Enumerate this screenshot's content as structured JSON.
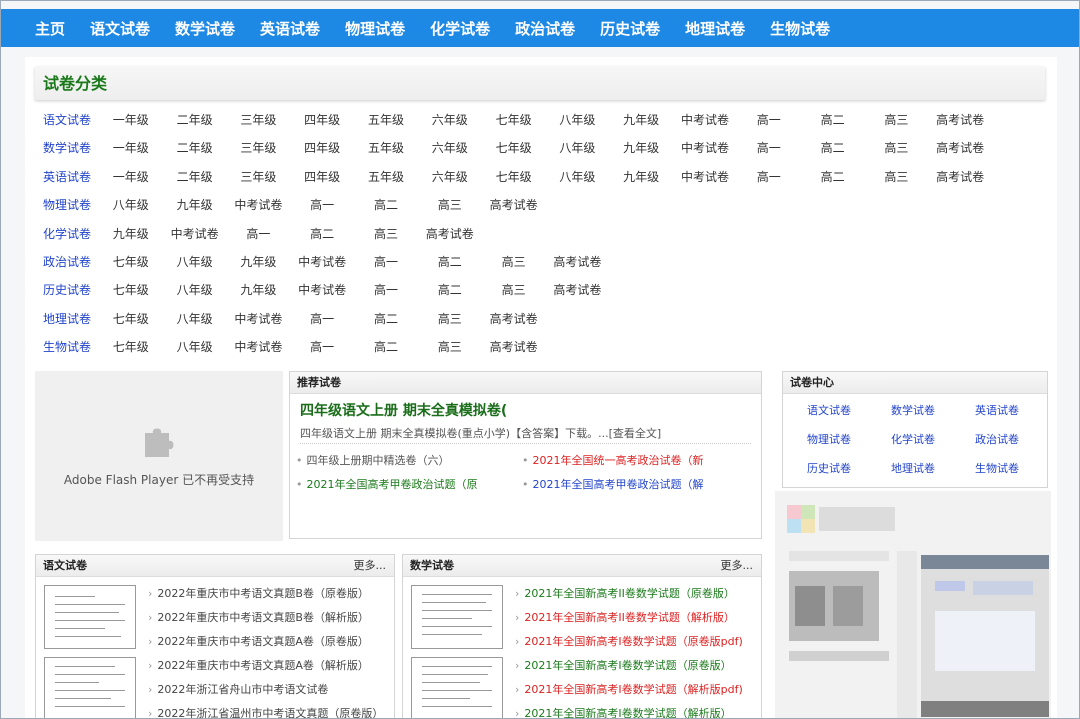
{
  "nav": [
    "主页",
    "语文试卷",
    "数学试卷",
    "英语试卷",
    "物理试卷",
    "化学试卷",
    "政治试卷",
    "历史试卷",
    "地理试卷",
    "生物试卷"
  ],
  "category": {
    "title": "试卷分类",
    "rows": [
      [
        "语文试卷",
        "一年级",
        "二年级",
        "三年级",
        "四年级",
        "五年级",
        "六年级",
        "七年级",
        "八年级",
        "九年级",
        "中考试卷",
        "高一",
        "高二",
        "高三",
        "高考试卷"
      ],
      [
        "数学试卷",
        "一年级",
        "二年级",
        "三年级",
        "四年级",
        "五年级",
        "六年级",
        "七年级",
        "八年级",
        "九年级",
        "中考试卷",
        "高一",
        "高二",
        "高三",
        "高考试卷"
      ],
      [
        "英语试卷",
        "一年级",
        "二年级",
        "三年级",
        "四年级",
        "五年级",
        "六年级",
        "七年级",
        "八年级",
        "九年级",
        "中考试卷",
        "高一",
        "高二",
        "高三",
        "高考试卷"
      ],
      [
        "物理试卷",
        "八年级",
        "九年级",
        "中考试卷",
        "高一",
        "高二",
        "高三",
        "高考试卷"
      ],
      [
        "化学试卷",
        "九年级",
        "中考试卷",
        "高一",
        "高二",
        "高三",
        "高考试卷"
      ],
      [
        "政治试卷",
        "七年级",
        "八年级",
        "九年级",
        "中考试卷",
        "高一",
        "高二",
        "高三",
        "高考试卷"
      ],
      [
        "历史试卷",
        "七年级",
        "八年级",
        "九年级",
        "中考试卷",
        "高一",
        "高二",
        "高三",
        "高考试卷"
      ],
      [
        "地理试卷",
        "七年级",
        "八年级",
        "中考试卷",
        "高一",
        "高二",
        "高三",
        "高考试卷"
      ],
      [
        "生物试卷",
        "七年级",
        "八年级",
        "中考试卷",
        "高一",
        "高二",
        "高三",
        "高考试卷"
      ]
    ]
  },
  "flash": {
    "text": "Adobe Flash Player 已不再受支持",
    "icon": "puzzle-icon"
  },
  "recommend": {
    "header": "推荐试卷",
    "headline": "四年级语文上册 期末全真模拟卷(",
    "desc": "四年级语文上册 期末全真模拟卷(重点小学)【含答案】下载。...[查看全文]",
    "links": [
      {
        "text": "四年级上册期中精选卷（六）",
        "color": "#555555"
      },
      {
        "text": "2021年全国统一高考政治试卷（新",
        "color": "#dd2222"
      },
      {
        "text": "2021年全国高考甲卷政治试题（原",
        "color": "#1a7a1a"
      },
      {
        "text": "2021年全国高考甲卷政治试题（解",
        "color": "#2244cc"
      }
    ]
  },
  "center": {
    "header": "试卷中心",
    "items": [
      "语文试卷",
      "数学试卷",
      "英语试卷",
      "物理试卷",
      "化学试卷",
      "政治试卷",
      "历史试卷",
      "地理试卷",
      "生物试卷"
    ]
  },
  "yuwen": {
    "header": "语文试卷",
    "more": "更多...",
    "items": [
      "2022年重庆市中考语文真题B卷（原卷版）",
      "2022年重庆市中考语文真题B卷（解析版）",
      "2022年重庆市中考语文真题A卷（原卷版）",
      "2022年重庆市中考语文真题A卷（解析版）",
      "2022年浙江省舟山市中考语文试卷",
      "2022年浙江省温州市中考语文真题（原卷版）"
    ]
  },
  "shuxue": {
    "header": "数学试卷",
    "more": "更多...",
    "items": [
      {
        "text": "2021年全国新高考II卷数学试题（原卷版）",
        "color": "#1a7a1a"
      },
      {
        "text": "2021年全国新高考II卷数学试题（解析版）",
        "color": "#dd2222"
      },
      {
        "text": "2021年全国新高考I卷数学试题（原卷版pdf)",
        "color": "#dd2222"
      },
      {
        "text": "2021年全国新高考I卷数学试题（原卷版）",
        "color": "#1a7a1a"
      },
      {
        "text": "2021年全国新高考I卷数学试题（解析版pdf)",
        "color": "#dd2222"
      },
      {
        "text": "2021年全国新高考I卷数学试题（解析版）",
        "color": "#1a7a1a"
      }
    ]
  },
  "colors": {
    "nav": "#1e88e5",
    "title_green": "#1a7a1a",
    "link_blue": "#2244cc",
    "link_red": "#dd2222"
  }
}
